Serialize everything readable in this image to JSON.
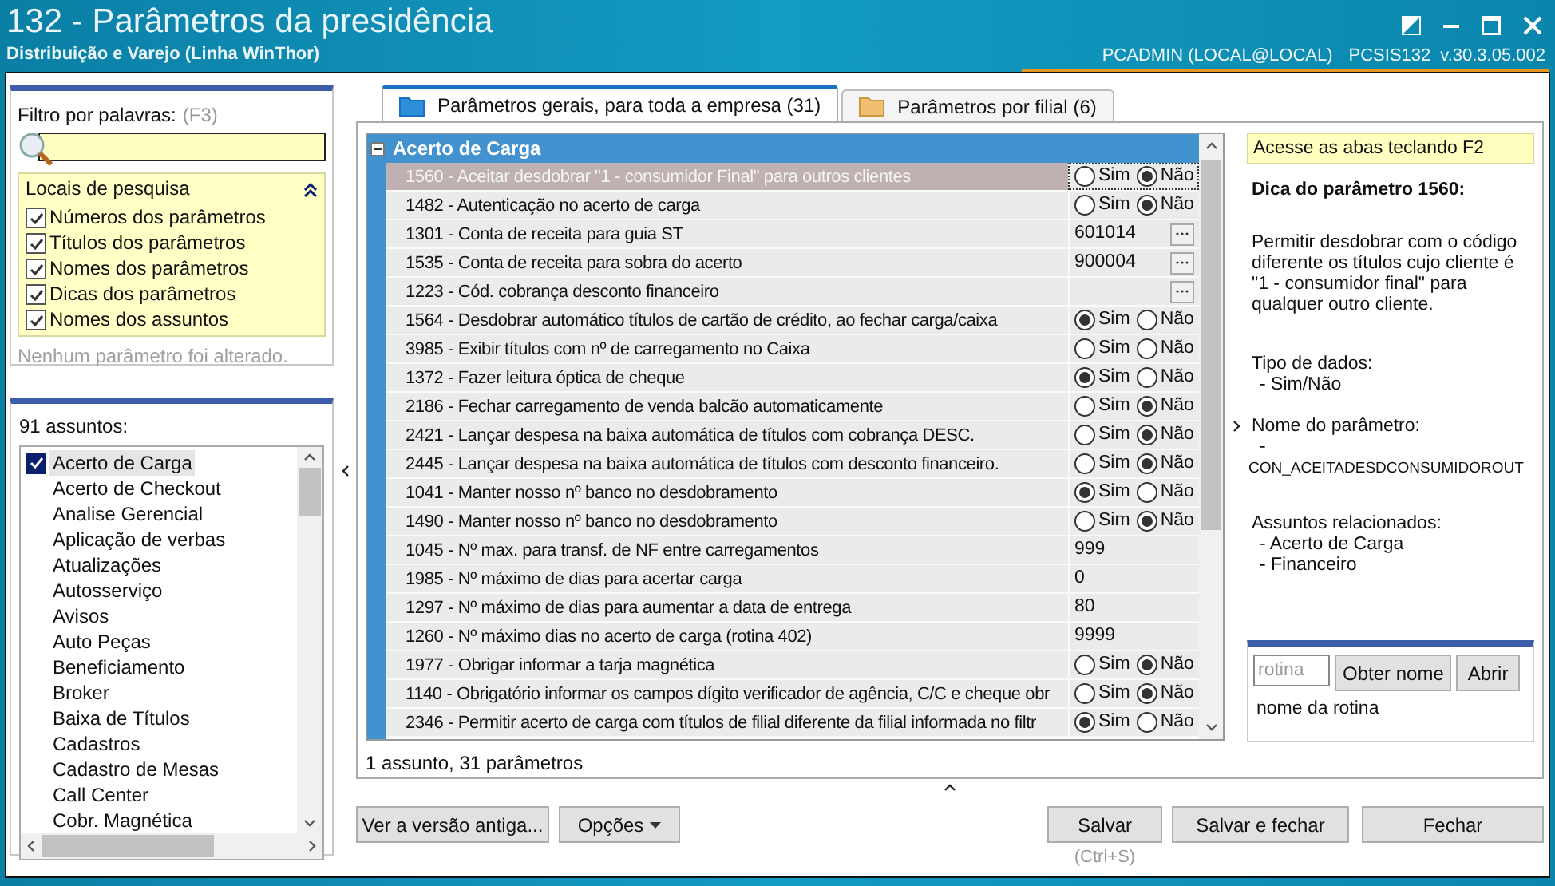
{
  "window": {
    "title": "132 - Parâmetros da presidência",
    "subtitle": "Distribuição e Varejo (Linha WinThor)",
    "user": "PCADMIN (LOCAL@LOCAL)",
    "routine": "PCSIS132",
    "version": "v.30.3.05.002"
  },
  "filter": {
    "label": "Filtro por palavras:",
    "shortcut": "(F3)",
    "locations": {
      "title": "Locais de pesquisa",
      "expanded": true,
      "options": [
        {
          "label": "Números dos parâmetros",
          "checked": true
        },
        {
          "label": "Títulos dos parâmetros",
          "checked": true
        },
        {
          "label": "Nomes dos parâmetros",
          "checked": true
        },
        {
          "label": "Dicas dos parâmetros",
          "checked": true
        },
        {
          "label": "Nomes dos assuntos",
          "checked": true
        }
      ]
    },
    "status": "Nenhum parâmetro foi alterado."
  },
  "subjects": {
    "count_label": "91 assuntos:",
    "items": [
      {
        "label": "Acerto de Carga",
        "selected": true,
        "checked": true
      },
      {
        "label": "Acerto de Checkout",
        "selected": false,
        "checked": false
      },
      {
        "label": "Analise Gerencial",
        "selected": false,
        "checked": false
      },
      {
        "label": "Aplicação de verbas",
        "selected": false,
        "checked": false
      },
      {
        "label": "Atualizações",
        "selected": false,
        "checked": false
      },
      {
        "label": "Autosserviço",
        "selected": false,
        "checked": false
      },
      {
        "label": "Avisos",
        "selected": false,
        "checked": false
      },
      {
        "label": "Auto Peças",
        "selected": false,
        "checked": false
      },
      {
        "label": "Beneficiamento",
        "selected": false,
        "checked": false
      },
      {
        "label": "Broker",
        "selected": false,
        "checked": false
      },
      {
        "label": "Baixa de Títulos",
        "selected": false,
        "checked": false
      },
      {
        "label": "Cadastros",
        "selected": false,
        "checked": false
      },
      {
        "label": "Cadastro de Mesas",
        "selected": false,
        "checked": false
      },
      {
        "label": "Call Center",
        "selected": false,
        "checked": false
      },
      {
        "label": "Cobr. Magnética",
        "selected": false,
        "checked": false
      }
    ]
  },
  "tabs": [
    {
      "label": "Parâmetros gerais, para toda a empresa",
      "count": "(31)",
      "selected": true
    },
    {
      "label": "Parâmetros por filial",
      "count": "(6)",
      "selected": false
    }
  ],
  "group": {
    "title": "Acerto de Carga",
    "expanded": true
  },
  "parameters": [
    {
      "label": "1560 - Aceitar desdobrar \"1 - consumidor Final\" para outros clientes",
      "selected": true,
      "kind": "bool",
      "options": [
        {
          "label": "Sim",
          "selected": false
        },
        {
          "label": "Não",
          "selected": true
        }
      ]
    },
    {
      "label": "1482 - Autenticação no acerto de carga",
      "selected": false,
      "kind": "bool",
      "options": [
        {
          "label": "Sim",
          "selected": false
        },
        {
          "label": "Não",
          "selected": true
        }
      ]
    },
    {
      "label": "1301 - Conta de receita para guia ST",
      "selected": false,
      "kind": "lookup",
      "value": "601014"
    },
    {
      "label": "1535 - Conta de receita para sobra do acerto",
      "selected": false,
      "kind": "lookup",
      "value": "900004"
    },
    {
      "label": "1223 - Cód. cobrança desconto financeiro",
      "selected": false,
      "kind": "lookup"
    },
    {
      "label": "1564 - Desdobrar automático títulos de cartão de crédito, ao fechar carga/caixa",
      "selected": false,
      "kind": "bool",
      "options": [
        {
          "label": "Sim",
          "selected": true
        },
        {
          "label": "Não",
          "selected": false
        }
      ]
    },
    {
      "label": "3985 - Exibir títulos com nº de carregamento no Caixa",
      "selected": false,
      "kind": "bool",
      "options": [
        {
          "label": "Sim",
          "selected": false
        },
        {
          "label": "Não",
          "selected": false
        }
      ]
    },
    {
      "label": "1372 - Fazer leitura óptica de cheque",
      "selected": false,
      "kind": "bool",
      "options": [
        {
          "label": "Sim",
          "selected": true
        },
        {
          "label": "Não",
          "selected": false
        }
      ]
    },
    {
      "label": "2186 - Fechar carregamento de venda balcão automaticamente",
      "selected": false,
      "kind": "bool",
      "options": [
        {
          "label": "Sim",
          "selected": false
        },
        {
          "label": "Não",
          "selected": true
        }
      ]
    },
    {
      "label": "2421 - Lançar despesa na baixa automática de títulos com cobrança DESC.",
      "selected": false,
      "kind": "bool",
      "options": [
        {
          "label": "Sim",
          "selected": false
        },
        {
          "label": "Não",
          "selected": true
        }
      ]
    },
    {
      "label": "2445 - Lançar despesa na baixa automática de títulos com desconto financeiro.",
      "selected": false,
      "kind": "bool",
      "options": [
        {
          "label": "Sim",
          "selected": false
        },
        {
          "label": "Não",
          "selected": true
        }
      ]
    },
    {
      "label": "1041 - Manter nosso nº banco no desdobramento",
      "selected": false,
      "kind": "bool",
      "options": [
        {
          "label": "Sim",
          "selected": true
        },
        {
          "label": "Não",
          "selected": false
        }
      ]
    },
    {
      "label": "1490 - Manter nosso nº banco no desdobramento",
      "selected": false,
      "kind": "bool",
      "options": [
        {
          "label": "Sim",
          "selected": false
        },
        {
          "label": "Não",
          "selected": true
        }
      ]
    },
    {
      "label": "1045 - Nº max. para transf. de NF entre carregamentos",
      "selected": false,
      "kind": "number",
      "value": "999"
    },
    {
      "label": "1985 - Nº máximo de dias para acertar carga",
      "selected": false,
      "kind": "number",
      "value": "0"
    },
    {
      "label": "1297 - Nº máximo de dias para aumentar a data de entrega",
      "selected": false,
      "kind": "number",
      "value": "80"
    },
    {
      "label": "1260 - Nº máximo dias no acerto de carga (rotina 402)",
      "selected": false,
      "kind": "number",
      "value": "9999"
    },
    {
      "label": "1977 - Obrigar informar a tarja magnética",
      "selected": false,
      "kind": "bool",
      "options": [
        {
          "label": "Sim",
          "selected": false
        },
        {
          "label": "Não",
          "selected": true
        }
      ]
    },
    {
      "label": "1140 - Obrigatório informar os campos dígito verificador de agência, C/C e cheque obr",
      "selected": false,
      "kind": "bool",
      "options": [
        {
          "label": "Sim",
          "selected": false
        },
        {
          "label": "Não",
          "selected": true
        }
      ]
    },
    {
      "label": "2346 - Permitir acerto de carga com títulos de filial diferente da filial informada no filtr",
      "selected": false,
      "kind": "bool",
      "options": [
        {
          "label": "Sim",
          "selected": true
        },
        {
          "label": "Não",
          "selected": false
        }
      ]
    }
  ],
  "status": "1 assunto, 31 parâmetros",
  "hint": {
    "banner": "Acesse as abas teclando F2",
    "title": "Dica do parâmetro 1560:",
    "description": "Permitir desdobrar com o código diferente os títulos cujo cliente é \"1 - consumidor final\" para qualquer outro cliente.",
    "data_type_label": "Tipo de dados:",
    "data_type": "- Sim/Não",
    "name_label": "Nome do parâmetro:",
    "name_prefix": "-",
    "name": "CON_ACEITADESDCONSUMIDOROUT",
    "related_label": "Assuntos relacionados:",
    "related": [
      "- Acerto de Carga",
      "- Financeiro"
    ]
  },
  "routine_lookup": {
    "placeholder": "rotina",
    "get_name_button": "Obter nome",
    "open_button": "Abrir",
    "result": "nome da rotina"
  },
  "buttons": {
    "old_version": "Ver a versão antiga...",
    "options": "Opções",
    "save": "Salvar",
    "save_shortcut": "(Ctrl+S)",
    "save_close": "Salvar e fechar",
    "close": "Fechar"
  }
}
